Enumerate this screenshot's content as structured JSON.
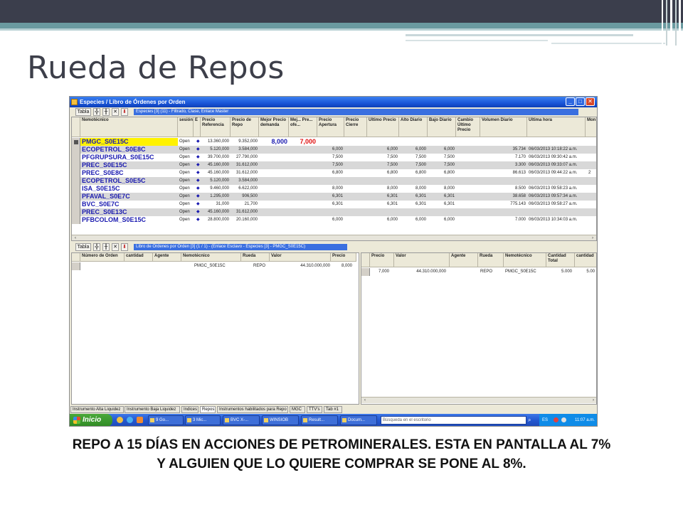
{
  "slide": {
    "title": "Rueda de Repos",
    "caption": "REPO A 15 DÍAS EN ACCIONES DE PETROMINERALES. ESTA EN PANTALLA AL 7% Y ALGUIEN QUE LO QUIERE COMPRAR SE PONE AL 8%."
  },
  "window": {
    "title": "Especies / Libro de Órdenes por Orden",
    "icons": [
      "minimize-icon",
      "maximize-icon",
      "close-icon"
    ]
  },
  "upper": {
    "table_button": "Tabla",
    "filter_label": "Especies [3] (11) - Filtrado, Clase, Enlace Master",
    "columns": [
      "Nemotécnico",
      "sesión",
      "E",
      "Precio Referencia",
      "Precio de Repo",
      "Mejor Precio demanda",
      "Mej... Pre... ofe...",
      "Precio Apertura",
      "Precio Cierre",
      "Último Precio",
      "Alto Diario",
      "Bajo Diario",
      "Cambio Último Precio",
      "Volumen Diario",
      "Última hora",
      "Mon"
    ],
    "highlight_demand": "8,000",
    "highlight_offer": "7,000",
    "rows": [
      {
        "nemo": "PMGC_S0E15C",
        "sesion": "Open",
        "ref": "13.360,000",
        "repo": "9.352,000",
        "apertura": "",
        "ultimo": "",
        "alto": "",
        "bajo": "",
        "vol": "",
        "hora": "",
        "mon": ""
      },
      {
        "nemo": "ECOPETROL_S0E8C",
        "sesion": "Open",
        "ref": "5.120,000",
        "repo": "3.584,000",
        "apertura": "6,000",
        "ultimo": "6,000",
        "alto": "6,000",
        "bajo": "6,000",
        "vol": "35.734",
        "hora": "06/03/2013 10:18:22 a.m.",
        "mon": ""
      },
      {
        "nemo": "PFGRUPSURA_S0E15C",
        "sesion": "Open",
        "ref": "39.700,000",
        "repo": "27.790,000",
        "apertura": "7,500",
        "ultimo": "7,500",
        "alto": "7,500",
        "bajo": "7,500",
        "vol": "7.170",
        "hora": "06/03/2013 09:30:42 a.m.",
        "mon": ""
      },
      {
        "nemo": "PREC_S0E15C",
        "sesion": "Open",
        "ref": "45.160,000",
        "repo": "31.612,000",
        "apertura": "7,500",
        "ultimo": "7,500",
        "alto": "7,500",
        "bajo": "7,500",
        "vol": "3.300",
        "hora": "06/03/2013 09:33:07 a.m.",
        "mon": ""
      },
      {
        "nemo": "PREC_S0E8C",
        "sesion": "Open",
        "ref": "45.160,000",
        "repo": "31.612,000",
        "apertura": "6,800",
        "ultimo": "6,800",
        "alto": "6,800",
        "bajo": "6,800",
        "vol": "86.613",
        "hora": "06/03/2013 09:44:22 a.m.",
        "mon": "2"
      },
      {
        "nemo": "ECOPETROL_S0E5C",
        "sesion": "Open",
        "ref": "5.120,000",
        "repo": "3.584,000",
        "apertura": "",
        "ultimo": "",
        "alto": "",
        "bajo": "",
        "vol": "",
        "hora": "",
        "mon": ""
      },
      {
        "nemo": "ISA_S0E15C",
        "sesion": "Open",
        "ref": "9.460,000",
        "repo": "6.622,000",
        "apertura": "8,000",
        "ultimo": "8,000",
        "alto": "8,000",
        "bajo": "8,000",
        "vol": "8.500",
        "hora": "06/03/2013 09:58:23 a.m.",
        "mon": ""
      },
      {
        "nemo": "PFAVAL_S0E7C",
        "sesion": "Open",
        "ref": "1.295,000",
        "repo": "906,500",
        "apertura": "6,301",
        "ultimo": "6,301",
        "alto": "6,301",
        "bajo": "6,301",
        "vol": "38.658",
        "hora": "06/03/2013 09:57:34 a.m.",
        "mon": ""
      },
      {
        "nemo": "BVC_S0E7C",
        "sesion": "Open",
        "ref": "31,000",
        "repo": "21,700",
        "apertura": "6,301",
        "ultimo": "6,301",
        "alto": "6,301",
        "bajo": "6,301",
        "vol": "775.143",
        "hora": "06/03/2013 09:58:27 a.m.",
        "mon": ""
      },
      {
        "nemo": "PREC_S0E13C",
        "sesion": "Open",
        "ref": "45.160,000",
        "repo": "31.612,000",
        "apertura": "",
        "ultimo": "",
        "alto": "",
        "bajo": "",
        "vol": "",
        "hora": "",
        "mon": ""
      },
      {
        "nemo": "PFBCOLOM_S0E15C",
        "sesion": "Open",
        "ref": "28.800,000",
        "repo": "20.160,000",
        "apertura": "6,000",
        "ultimo": "6,000",
        "alto": "6,000",
        "bajo": "6,000",
        "vol": "7.000",
        "hora": "06/03/2013 10:34:03 a.m.",
        "mon": ""
      }
    ]
  },
  "lower": {
    "table_button": "Tabla",
    "filter_label": "Libro de Órdenes por Orden [3] (1 / 1) - (Enlace Esclavo - Especies [3] - PMGC_S0E15C)",
    "left_columns": [
      "Número de Orden",
      "cantidad",
      "Agente",
      "Nemotécnico",
      "Rueda",
      "Valor",
      "Precio"
    ],
    "left_row": {
      "nemo": "PMGC_S0E15C",
      "rueda": "REPO",
      "valor": "44.310.000,000",
      "precio": "8,000"
    },
    "right_columns": [
      "Precio",
      "Valor",
      "Agente",
      "Rueda",
      "Nemotécnico",
      "Cantidad Total",
      "cantidad"
    ],
    "right_row": {
      "precio": "7,000",
      "valor": "44.310.000,000",
      "rueda": "REPO",
      "nemo": "PMGC_S0E15C",
      "total": "5.000",
      "cantidad": "5.00"
    }
  },
  "tabs": [
    "Instrumento Alta Liquidez",
    "Instrumento Baja Liquidez",
    "Indices",
    "Repos",
    "Instrumentos habilitados para Repo",
    "MGC",
    "TTV's",
    "Tab #1"
  ],
  "active_tab": "Repos",
  "taskbar": {
    "start": "Inicio",
    "items": [
      "9 Go...",
      "3 Mic...",
      "BVC X-...",
      "WINSIOB",
      "Result...",
      "Docum..."
    ],
    "search_placeholder": "Búsqueda en el escritorio",
    "lang": "ES",
    "time": "11:07 a.m."
  }
}
